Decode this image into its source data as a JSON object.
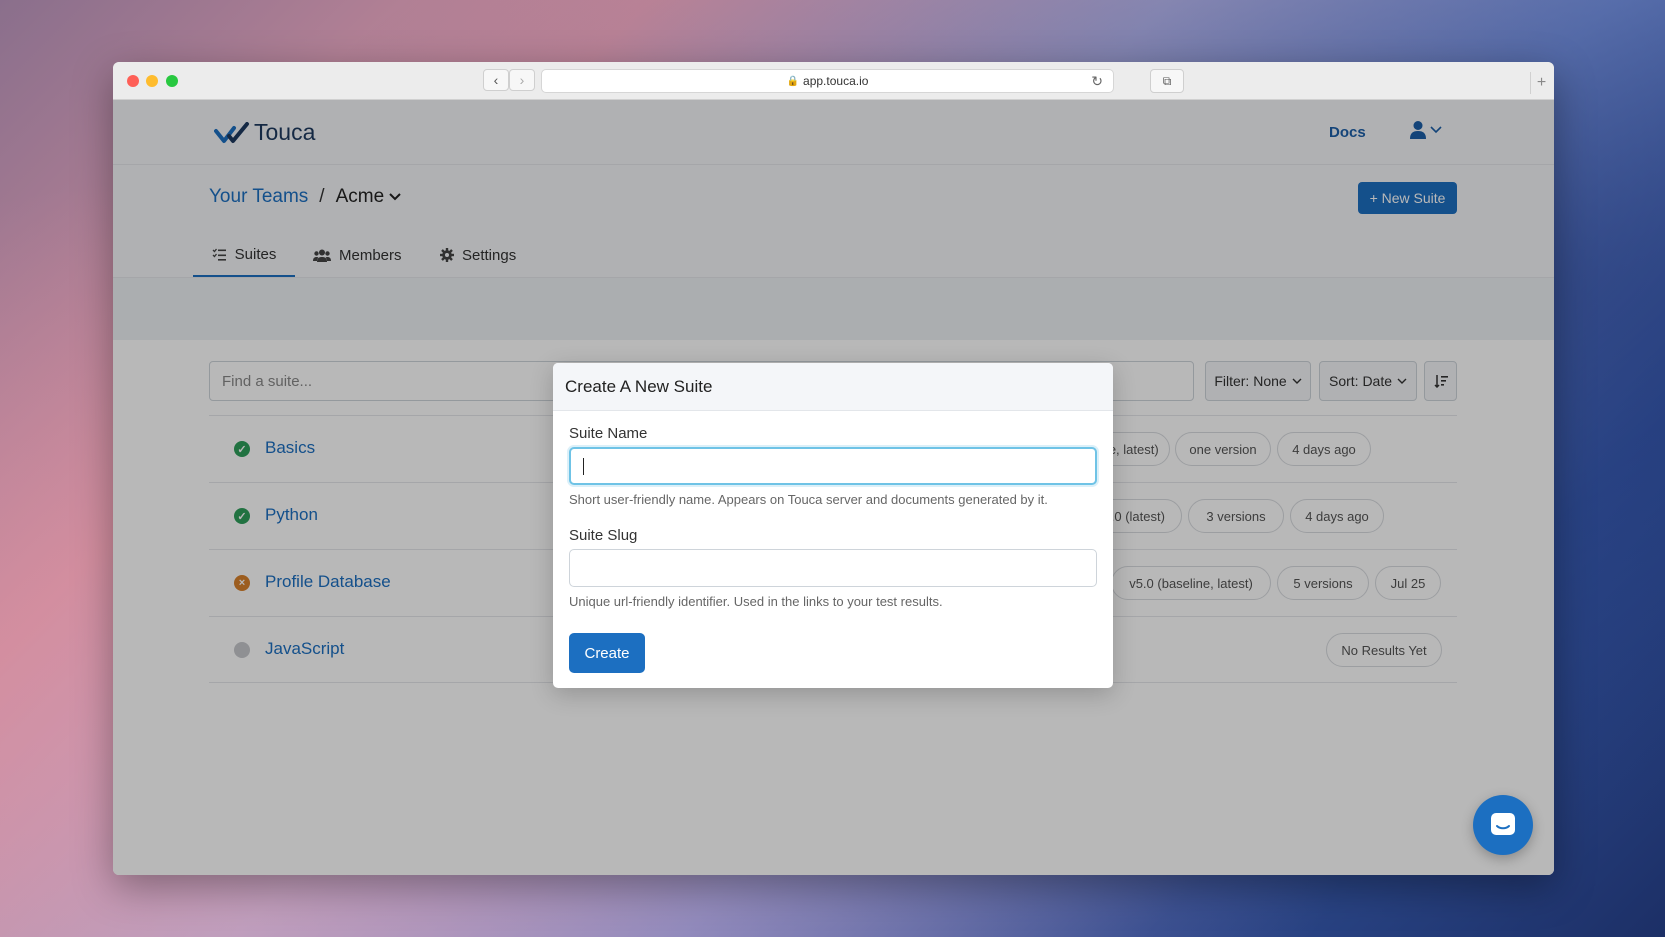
{
  "browser": {
    "url": "app.touca.io",
    "lock_icon": "lock-icon",
    "reload_icon": "reload-icon"
  },
  "header": {
    "logo_text": "Touca",
    "docs_label": "Docs",
    "user_icon": "user-icon"
  },
  "breadcrumb": {
    "teams_label": "Your Teams",
    "separator": "/",
    "team_name": "Acme"
  },
  "actions": {
    "new_suite_label": "+ New Suite"
  },
  "tabs": [
    {
      "label": "Suites",
      "icon": "list-icon",
      "active": true
    },
    {
      "label": "Members",
      "icon": "users-icon",
      "active": false
    },
    {
      "label": "Settings",
      "icon": "gear-icon",
      "active": false
    }
  ],
  "toolbar": {
    "search_placeholder": "Find a suite...",
    "filter_label": "Filter: None",
    "sort_label": "Sort: Date"
  },
  "suites": [
    {
      "name": "Basics",
      "status": "pass",
      "pills": [
        "(baseline, latest)",
        "one version",
        "4 days ago"
      ]
    },
    {
      "name": "Python",
      "status": "pass",
      "pills": [
        "v3.0 (latest)",
        "3 versions",
        "4 days ago"
      ]
    },
    {
      "name": "Profile Database",
      "status": "fail",
      "pills": [
        "v5.0 (baseline, latest)",
        "5 versions",
        "Jul 25"
      ]
    },
    {
      "name": "JavaScript",
      "status": "none",
      "pills": [
        "No Results Yet"
      ]
    }
  ],
  "modal": {
    "title": "Create A New Suite",
    "name_label": "Suite Name",
    "name_value": "",
    "name_help": "Short user-friendly name. Appears on Touca server and documents generated by it.",
    "slug_label": "Suite Slug",
    "slug_value": "",
    "slug_help": "Unique url-friendly identifier. Used in the links to your test results.",
    "create_label": "Create"
  },
  "colors": {
    "primary": "#1c6fc1",
    "pass": "#2e9e5b",
    "fail": "#d9822b",
    "none": "#c6c8cc"
  }
}
